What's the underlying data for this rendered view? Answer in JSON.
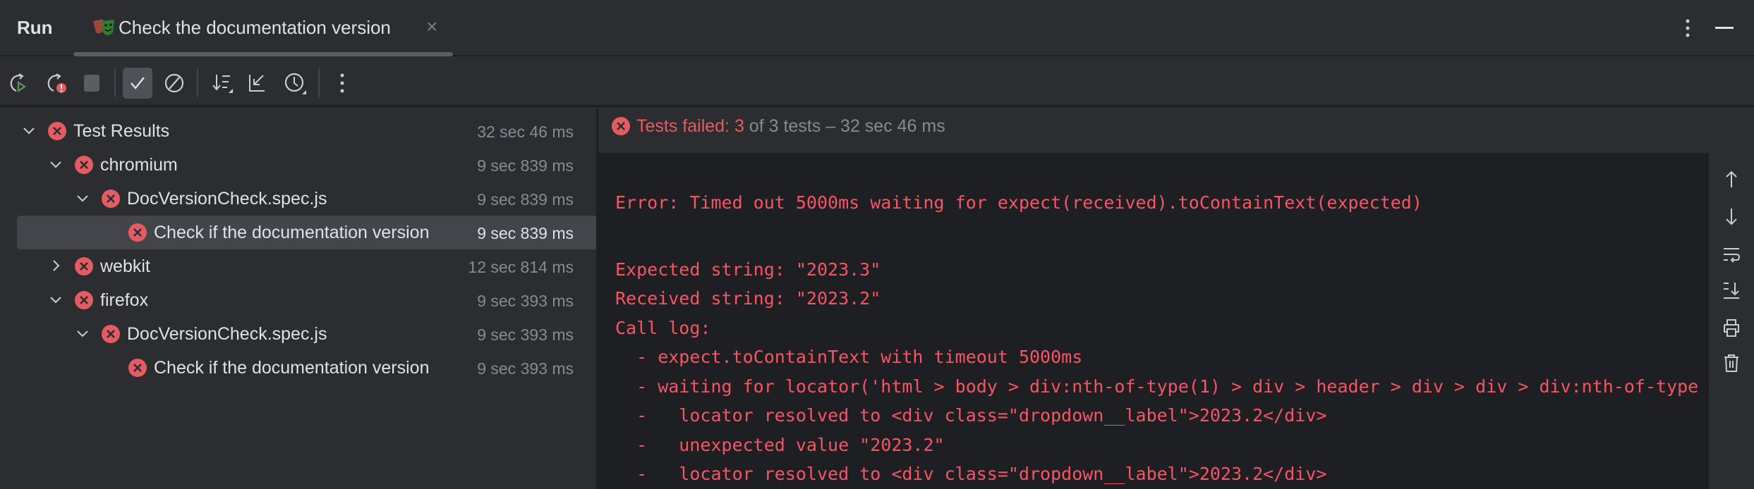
{
  "topbar": {
    "run_label": "Run",
    "tab_title": "Check the documentation version",
    "tab_close": "×"
  },
  "toolbar": {
    "items": [
      "rerun-icon",
      "rerun-failed-icon",
      "stop-icon",
      "show-passed-icon",
      "show-ignored-icon",
      "sort-icon",
      "collapse-icon",
      "history-icon",
      "more-icon"
    ]
  },
  "tree": [
    {
      "label": "Test Results",
      "time": "32 sec 46 ms",
      "level": 0,
      "expanded": true,
      "status": "failed"
    },
    {
      "label": "chromium",
      "time": "9 sec 839 ms",
      "level": 1,
      "expanded": true,
      "status": "failed"
    },
    {
      "label": "DocVersionCheck.spec.js",
      "time": "9 sec 839 ms",
      "level": 2,
      "expanded": true,
      "status": "failed"
    },
    {
      "label": "Check if the documentation version",
      "time": "9 sec 839 ms",
      "level": 3,
      "selected": true,
      "status": "failed"
    },
    {
      "label": "webkit",
      "time": "12 sec 814 ms",
      "level": 1,
      "expanded": false,
      "status": "failed"
    },
    {
      "label": "firefox",
      "time": "9 sec 393 ms",
      "level": 1,
      "expanded": true,
      "status": "failed"
    },
    {
      "label": "DocVersionCheck.spec.js",
      "time": "9 sec 393 ms",
      "level": 2,
      "expanded": true,
      "status": "failed"
    },
    {
      "label": "Check if the documentation version",
      "time": "9 sec 393 ms",
      "level": 3,
      "status": "failed"
    }
  ],
  "status": {
    "prefix": "Tests failed: 3",
    "suffix": " of 3 tests – 32 sec 46 ms"
  },
  "console": {
    "lines": [
      "Error: Timed out 5000ms waiting for expect(received).toContainText(expected)",
      "Expected string: \"2023.3\"",
      "Received string: \"2023.2\"",
      "Call log:",
      "  - expect.toContainText with timeout 5000ms",
      "  - waiting for locator('html > body > div:nth-of-type(1) > div > header > div > div > div:nth-of-type",
      "  -   locator resolved to <div class=\"dropdown__label\">2023.2</div>",
      "  -   unexpected value \"2023.2\"",
      "  -   locator resolved to <div class=\"dropdown__label\">2023.2</div>"
    ]
  },
  "colors": {
    "error": "#e55b62",
    "console_text": "#f75464",
    "bg": "#2b2d30",
    "console_bg": "#1e1f22"
  }
}
